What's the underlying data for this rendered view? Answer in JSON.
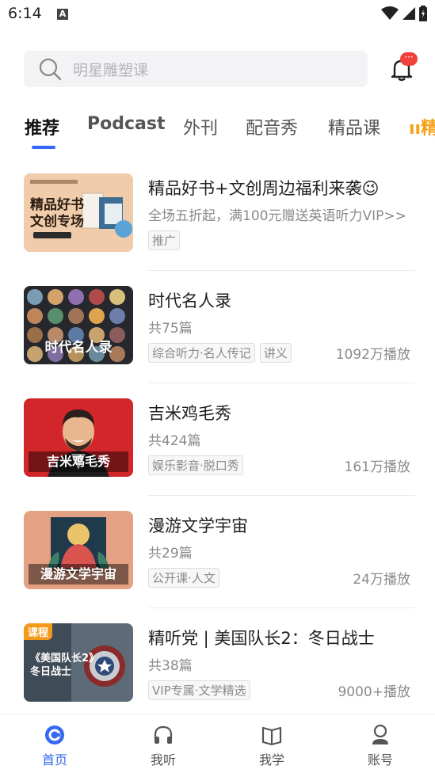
{
  "status": {
    "time": "6:14",
    "notification_letter": "A"
  },
  "search": {
    "placeholder": "明星雕塑课"
  },
  "notifications": {
    "badge": "···"
  },
  "tabs": [
    {
      "label": "推荐",
      "active": true
    },
    {
      "label": "Podcast"
    },
    {
      "label": "外刊"
    },
    {
      "label": "配音秀"
    },
    {
      "label": "精品课"
    },
    {
      "label": "精"
    }
  ],
  "items": [
    {
      "title": "精品好书+文创周边福利来袭😉",
      "subtitle": "全场五折起，满100元赠送英语听力VIP>>",
      "tags": [
        "推广"
      ],
      "plays": "",
      "thumb_caption_line1": "精品好书",
      "thumb_caption_line2": "文创专场"
    },
    {
      "title": "时代名人录",
      "subtitle": "共75篇",
      "tags": [
        "综合听力·名人传记",
        "讲义"
      ],
      "plays": "1092万播放",
      "thumb_caption": "时代名人录"
    },
    {
      "title": "吉米鸡毛秀",
      "subtitle": "共424篇",
      "tags": [
        "娱乐影音·脱口秀"
      ],
      "plays": "161万播放",
      "thumb_caption": "吉米鸡毛秀"
    },
    {
      "title": "漫游文学宇宙",
      "subtitle": "共29篇",
      "tags": [
        "公开课·人文"
      ],
      "plays": "24万播放",
      "thumb_caption": "漫游文学宇宙"
    },
    {
      "title": "精听党 | 美国队长2：冬日战士",
      "subtitle": "共38篇",
      "tags": [
        "VIP专属·文学精选"
      ],
      "plays": "9000+播放",
      "thumb_badge": "课程",
      "thumb_caption_line1": "《美国队长2》",
      "thumb_caption_line2": "冬日战士"
    }
  ],
  "bottom_nav": [
    {
      "label": "首页",
      "icon": "home-icon",
      "active": true
    },
    {
      "label": "我听",
      "icon": "headphones-icon"
    },
    {
      "label": "我学",
      "icon": "book-icon"
    },
    {
      "label": "账号",
      "icon": "account-icon"
    }
  ],
  "colors": {
    "accent": "#3468f5",
    "badge_red": "#f0413a",
    "course_orange": "#f49a1a"
  }
}
